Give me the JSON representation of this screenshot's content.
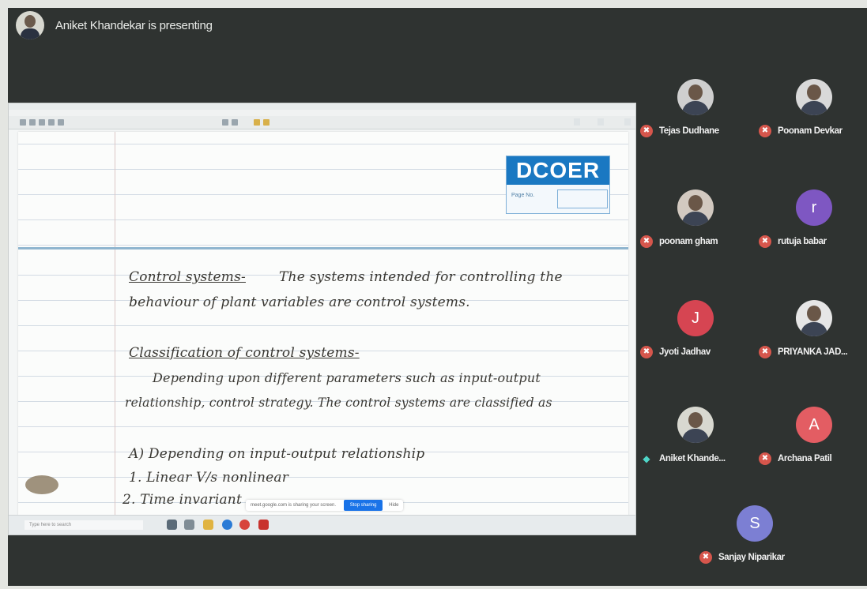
{
  "header": {
    "presenting_text": "Aniket Khandekar is presenting"
  },
  "shared_screen": {
    "logo_text": "DCOER",
    "page_no_label": "Page No.",
    "notes": [
      {
        "text": "Control systems-",
        "underline": true
      },
      {
        "text": "The systems intended for controlling the",
        "underline": false
      },
      {
        "text": "behaviour of plant variables are control systems.",
        "underline": false
      },
      {
        "text": "Classification of control systems-",
        "underline": true
      },
      {
        "text": "Depending upon different parameters such as input-output",
        "underline": false
      },
      {
        "text": "relationship, control strategy. The control systems are classified as",
        "underline": false
      },
      {
        "text": "A) Depending on input-output relationship",
        "underline": false
      },
      {
        "text": "1. Linear V/s nonlinear",
        "underline": false
      },
      {
        "text": "2. Time invariant",
        "underline": false
      }
    ],
    "share_bar": {
      "text": "meet.google.com is sharing your screen.",
      "stop_label": "Stop sharing",
      "hide_label": "Hide"
    },
    "taskbar_search": "Type here to search"
  },
  "participants": [
    {
      "name": "Tejas Dudhane",
      "avatar_type": "photo",
      "initial": "",
      "color": "#cfcfcf",
      "muted": true
    },
    {
      "name": "Poonam Devkar",
      "avatar_type": "photo",
      "initial": "",
      "color": "#d9d9d9",
      "muted": true
    },
    {
      "name": "poonam gham",
      "avatar_type": "photo",
      "initial": "",
      "color": "#d2c9c0",
      "muted": true
    },
    {
      "name": "rutuja babar",
      "avatar_type": "letter",
      "initial": "r",
      "color": "#7e57c2",
      "muted": true
    },
    {
      "name": "Jyoti Jadhav",
      "avatar_type": "letter",
      "initial": "J",
      "color": "#d64552",
      "muted": true
    },
    {
      "name": "PRIYANKA JAD...",
      "avatar_type": "photo",
      "initial": "",
      "color": "#e6e6e6",
      "muted": true
    },
    {
      "name": "Aniket Khande...",
      "avatar_type": "photo",
      "initial": "",
      "color": "#d8d8d0",
      "muted": false
    },
    {
      "name": "Archana Patil",
      "avatar_type": "letter",
      "initial": "A",
      "color": "#e35d63",
      "muted": true
    },
    {
      "name": "Sanjay Niparikar",
      "avatar_type": "letter",
      "initial": "S",
      "color": "#7c7fd3",
      "muted": true
    }
  ]
}
